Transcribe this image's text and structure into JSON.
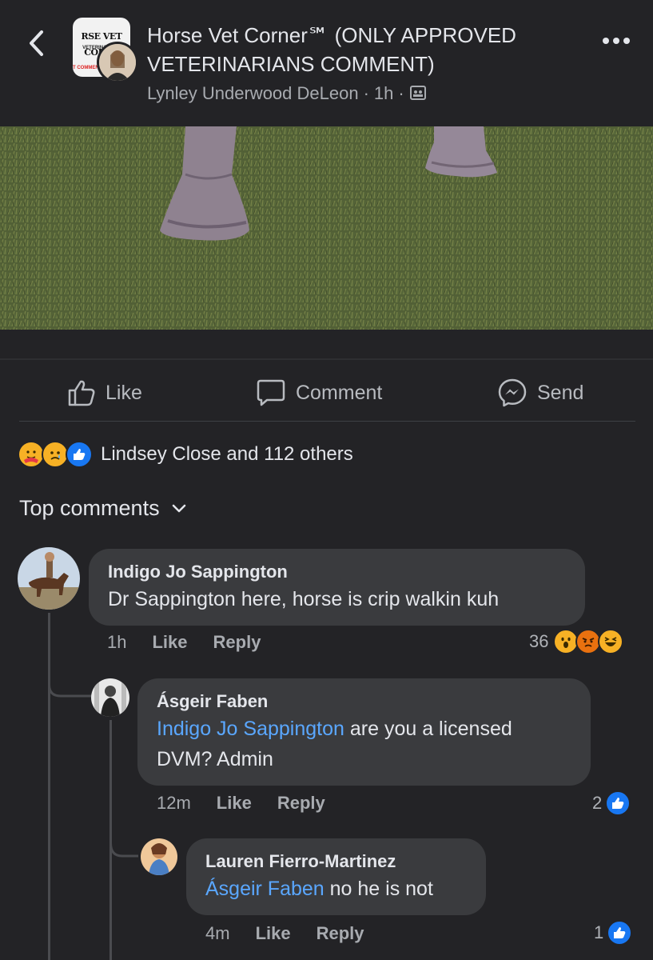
{
  "header": {
    "group_name": "Horse Vet Corner℠ (ONLY APPROVED VETERINARIANS COMMENT)",
    "author": "Lynley Underwood DeLeon",
    "time": "1h",
    "avatar_banner": "RSE VET CORNE",
    "avatar_sub": "VETERINARY LE",
    "avatar_red": "T COMMENT"
  },
  "actions": {
    "like": "Like",
    "comment": "Comment",
    "send": "Send"
  },
  "reactions_summary": {
    "text": "Lindsey Close and 112 others"
  },
  "top_comments_label": "Top comments",
  "comments": [
    {
      "name": "Indigo Jo Sappington",
      "text": "Dr Sappington here, horse is crip walkin kuh",
      "time": "1h",
      "like": "Like",
      "reply": "Reply",
      "reaction_count": "36"
    },
    {
      "name": "Ásgeir Faben",
      "mention": "Indigo Jo Sappington",
      "text_line1": " are you a licensed",
      "text_line2": "DVM? Admin",
      "time": "12m",
      "like": "Like",
      "reply": "Reply",
      "reaction_count": "2"
    },
    {
      "name": "Lauren Fierro-Martinez",
      "mention": "Ásgeir Faben",
      "text": " no he is not",
      "time": "4m",
      "like": "Like",
      "reply": "Reply",
      "reaction_count": "1"
    }
  ],
  "colors": {
    "background": "#232326",
    "bubble": "#3a3b3e",
    "mention": "#5aa7ff",
    "like_blue": "#1877f2"
  }
}
